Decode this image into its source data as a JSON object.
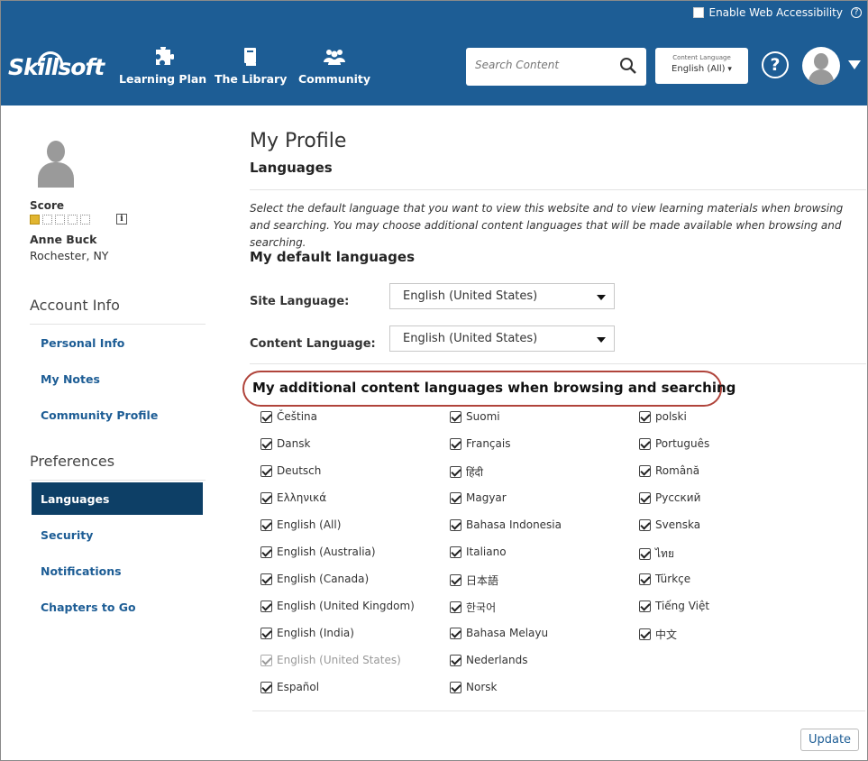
{
  "header": {
    "accessibility_label": "Enable Web Accessibility",
    "logo": "Skillsoft",
    "nav": [
      {
        "label": "Learning Plan",
        "icon": "puzzle-icon"
      },
      {
        "label": "The Library",
        "icon": "book-icon"
      },
      {
        "label": "Community",
        "icon": "people-icon"
      }
    ],
    "search_placeholder": "Search Content",
    "content_language_caption": "Content Language",
    "content_language_value": "English (All)",
    "help_label": "?"
  },
  "sidebar": {
    "score_label": "Score",
    "score_level": 1,
    "score_max": 5,
    "name": "Anne Buck",
    "location": "Rochester, NY",
    "account_heading": "Account Info",
    "account_links": [
      "Personal Info",
      "My Notes",
      "Community Profile"
    ],
    "pref_heading": "Preferences",
    "pref_links": [
      "Languages",
      "Security",
      "Notifications",
      "Chapters to Go"
    ],
    "active": "Languages"
  },
  "main": {
    "title": "My Profile",
    "section": "Languages",
    "intro": "Select the default language that you want to view this website and to view learning materials when browsing and searching. You may choose additional content languages that will be made available when browsing and searching.",
    "default_heading": "My default languages",
    "site_language_label": "Site Language:",
    "site_language_value": "English (United States)",
    "content_language_label": "Content Language:",
    "content_language_value": "English (United States)",
    "additional_heading": "My additional content languages when browsing and searching",
    "languages": {
      "col1": [
        "Čeština",
        "Dansk",
        "Deutsch",
        "Ελληνικά",
        "English (All)",
        "English (Australia)",
        "English (Canada)",
        "English (United Kingdom)",
        "English (India)",
        "English (United States)",
        "Español"
      ],
      "col2": [
        "Suomi",
        "Français",
        "हिंदी",
        "Magyar",
        "Bahasa Indonesia",
        "Italiano",
        "日本語",
        "한국어",
        "Bahasa Melayu",
        "Nederlands",
        "Norsk"
      ],
      "col3": [
        "polski",
        "Português",
        "Română",
        "Русский",
        "Svenska",
        "ไทย",
        "Türkçe",
        "Tiếng Việt",
        "中文"
      ]
    },
    "update_label": "Update"
  }
}
